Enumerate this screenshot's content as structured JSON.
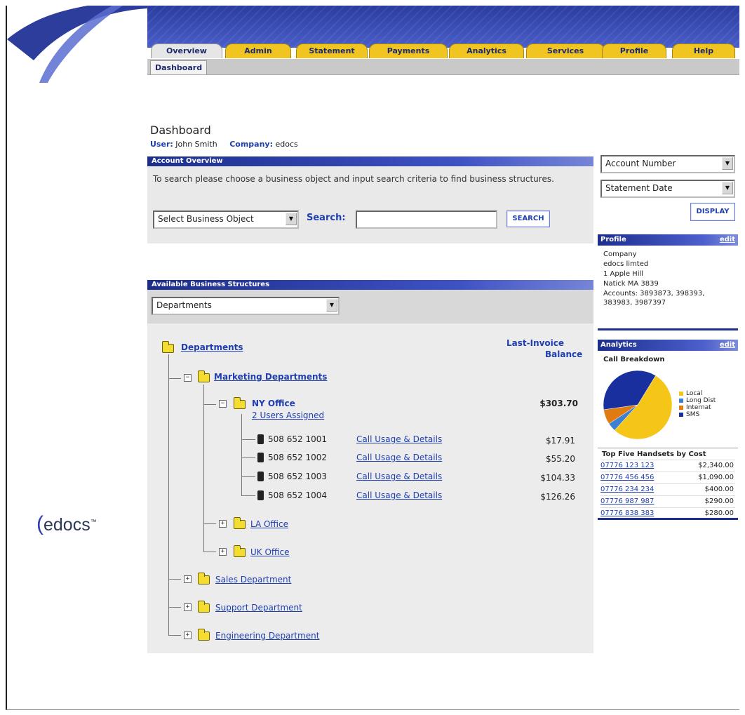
{
  "tabs": [
    {
      "label": "Overview",
      "active": true
    },
    {
      "label": "Admin"
    },
    {
      "label": "Statement"
    },
    {
      "label": "Payments"
    },
    {
      "label": "Analytics"
    },
    {
      "label": "Services"
    },
    {
      "label": "Profile"
    },
    {
      "label": "Help"
    }
  ],
  "subtab": "Dashboard",
  "page": {
    "title": "Dashboard",
    "user_label": "User:",
    "user": "John Smith",
    "company_label": "Company:",
    "company": "edocs"
  },
  "account_overview": {
    "header": "Account Overview",
    "instructions": "To search please choose a business object and input search criteria to find business structures.",
    "business_object_select": "Select Business Object",
    "search_label": "Search:",
    "search_value": "",
    "search_button": "SEARCH"
  },
  "structures": {
    "header": "Available Business Structures",
    "select": "Departments",
    "root": "Departments",
    "balance_header_1": "Last-Invoice",
    "balance_header_2": "Balance",
    "marketing": "Marketing Departments",
    "ny_office": "NY Office",
    "ny_users": "2 Users Assigned",
    "ny_balance": "$303.70",
    "phones": [
      {
        "number": "508 652 1001",
        "link": "Call Usage & Details",
        "amount": "$17.91"
      },
      {
        "number": "508 652 1002",
        "link": "Call Usage & Details",
        "amount": "$55.20"
      },
      {
        "number": "508 652 1003",
        "link": "Call Usage & Details",
        "amount": "$104.33"
      },
      {
        "number": "508 652 1004",
        "link": "Call Usage & Details",
        "amount": "$126.26"
      }
    ],
    "la_office": "LA Office",
    "uk_office": "UK Office",
    "sales": "Sales Department",
    "support": "Support Department",
    "engineering": "Engineering Department"
  },
  "sidebar": {
    "account_select": "Account Number",
    "date_select": "Statement Date",
    "display_button": "DISPLAY",
    "profile": {
      "header": "Profile",
      "edit": "edit",
      "lines": [
        "Company",
        "edocs limted",
        "1 Apple Hill",
        "Natick MA 3839",
        "Accounts: 3893873, 398393, 383983, 3987397"
      ]
    },
    "analytics": {
      "header": "Analytics",
      "edit": "edit",
      "chart_title": "Call Breakdown",
      "top_five_title": "Top Five Handsets by Cost",
      "top_five": [
        {
          "number": "07776 123 123",
          "amount": "$2,340.00"
        },
        {
          "number": "07776 456 456",
          "amount": "$1,090.00"
        },
        {
          "number": "07776 234 234",
          "amount": "$400.00"
        },
        {
          "number": "07776 987 987",
          "amount": "$290.00"
        },
        {
          "number": "07776 838 383",
          "amount": "$280.00"
        }
      ]
    }
  },
  "chart_data": {
    "type": "pie",
    "title": "Call Breakdown",
    "categories": [
      "Local",
      "Long Dist",
      "Internat",
      "SMS"
    ],
    "values": [
      53,
      4,
      7,
      36
    ],
    "colors": [
      "#f5c518",
      "#3d7fd1",
      "#e07b12",
      "#1a2f9e"
    ]
  },
  "logo": {
    "text": "edocs",
    "mark": "™"
  },
  "colors": {
    "accent": "#1c2e8c",
    "tab": "#f0c521",
    "link": "#1f3fb0"
  }
}
